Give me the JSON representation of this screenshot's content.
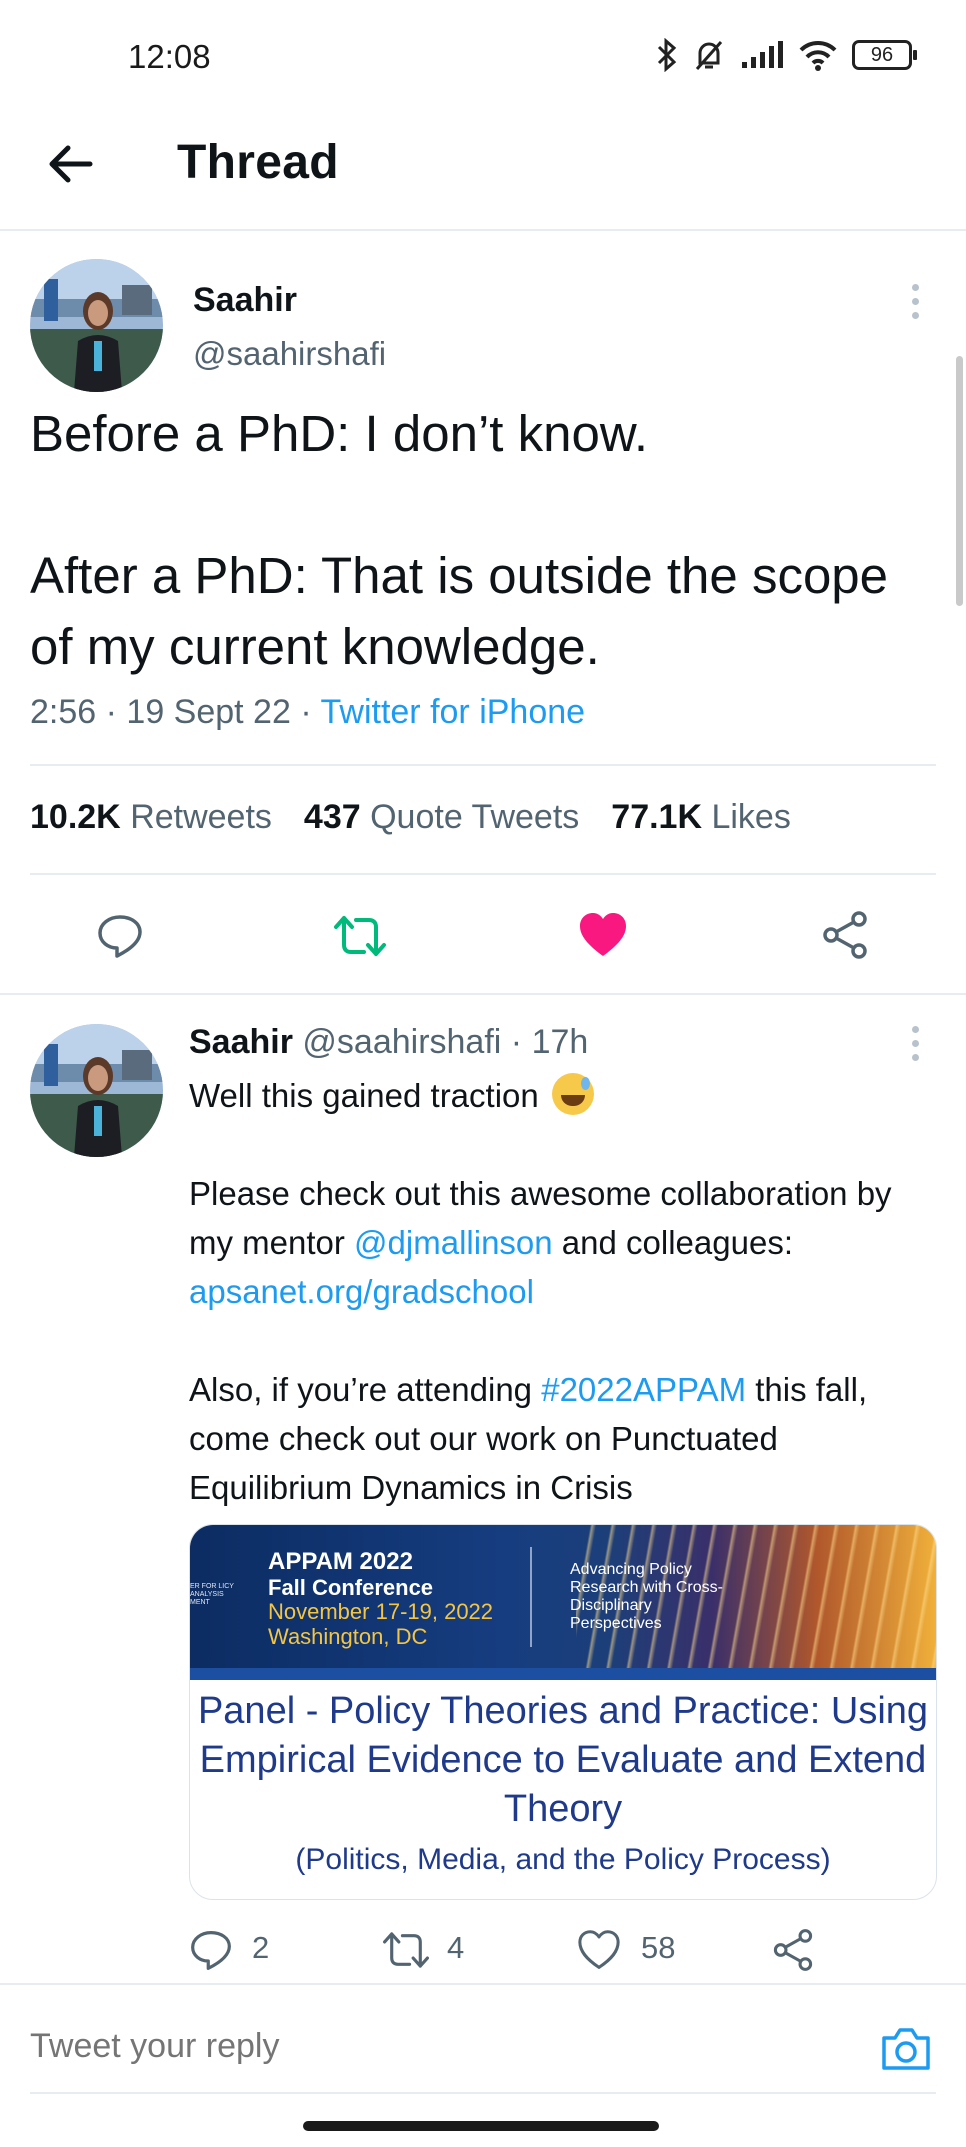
{
  "status_bar": {
    "time": "12:08",
    "battery": "96"
  },
  "header": {
    "title": "Thread"
  },
  "main_tweet": {
    "name": "Saahir",
    "handle": "@saahirshafi",
    "text_line1": "Before a PhD: I don’t know.",
    "text_line2": "After a PhD: That is outside the scope of my current knowledge.",
    "time": "2:56",
    "date": "19 Sept 22",
    "source": "Twitter for iPhone",
    "retweets": "10.2K",
    "retweets_label": "Retweets",
    "quotes": "437",
    "quotes_label": "Quote Tweets",
    "likes": "77.1K",
    "likes_label": "Likes"
  },
  "reply_tweet": {
    "name": "Saahir",
    "handle": "@saahirshafi",
    "age": "17h",
    "line1": "Well this gained traction",
    "p2_a": "Please check out this awesome collaboration by my mentor ",
    "p2_mention": "@djmallinson",
    "p2_b": " and colleagues: ",
    "p2_link": "apsanet.org/gradschool",
    "p3_a": "Also, if you’re attending ",
    "p3_hashtag": "#2022APPAM",
    "p3_b": " this fall, come check out our work on Punctuated Equilibrium Dynamics in Crisis",
    "card": {
      "banner_title": "APPAM 2022",
      "banner_sub": "Fall Conference",
      "banner_date": "November 17-19, 2022",
      "banner_place": "Washington, DC",
      "banner_right": "Advancing Policy Research with Cross-Disciplinary Perspectives",
      "banner_tiny": "ER FOR LICY ANALYSIS MENT",
      "title": "Panel - Policy Theories and Practice: Using Empirical Evidence to Evaluate and Extend Theory",
      "subtitle": "(Politics, Media, and the Policy Process)"
    },
    "replies": "2",
    "retweets": "4",
    "likes": "58"
  },
  "composer": {
    "placeholder": "Tweet your reply"
  },
  "colors": {
    "accent": "#1d9bf0",
    "retweet": "#00ba7c",
    "like": "#f91880"
  }
}
